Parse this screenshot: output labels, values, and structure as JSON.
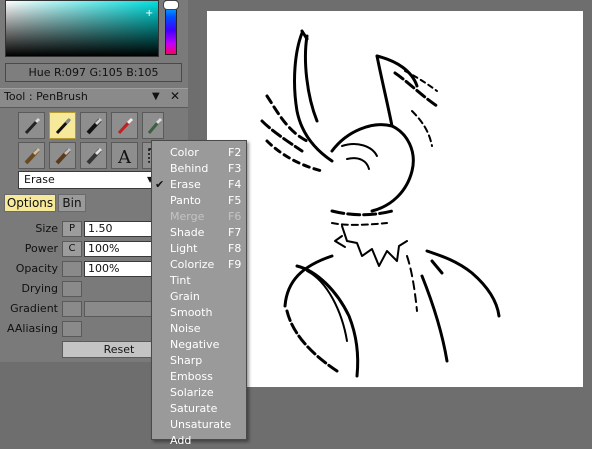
{
  "color_panel": {
    "readout": "Hue R:097 G:105 B:105"
  },
  "tool_panel": {
    "title": "Tool : PenBrush",
    "tools": [
      {
        "name": "pencil",
        "icon": "pencil-icon"
      },
      {
        "name": "pen-brush",
        "icon": "pen-brush-icon",
        "active": true
      },
      {
        "name": "marker",
        "icon": "marker-icon"
      },
      {
        "name": "airbrush",
        "icon": "airbrush-icon"
      },
      {
        "name": "blender",
        "icon": "blender-icon"
      },
      {
        "name": "paint-brush",
        "icon": "paint-brush-icon"
      },
      {
        "name": "water-brush",
        "icon": "water-brush-icon"
      },
      {
        "name": "smudge",
        "icon": "smudge-icon"
      },
      {
        "name": "text",
        "icon": "text-icon",
        "glyph": "A"
      },
      {
        "name": "select",
        "icon": "selection-icon"
      }
    ],
    "mode_value": "Erase",
    "tabs": {
      "options": "Options",
      "bin": "Bin"
    },
    "options": {
      "size": {
        "label": "Size",
        "button": "P",
        "value": "1.50"
      },
      "power": {
        "label": "Power",
        "button": "C",
        "value": "100%"
      },
      "opacity": {
        "label": "Opacity",
        "value": "100%"
      },
      "drying": {
        "label": "Drying"
      },
      "gradient": {
        "label": "Gradient"
      },
      "aaliasing": {
        "label": "AAliasing"
      },
      "reset": "Reset"
    }
  },
  "blend_menu": {
    "items": [
      {
        "label": "Color",
        "key": "F2"
      },
      {
        "label": "Behind",
        "key": "F3"
      },
      {
        "label": "Erase",
        "key": "F4",
        "checked": true
      },
      {
        "label": "Panto",
        "key": "F5"
      },
      {
        "label": "Merge",
        "key": "F6",
        "disabled": true
      },
      {
        "label": "Shade",
        "key": "F7"
      },
      {
        "label": "Light",
        "key": "F8"
      },
      {
        "label": "Colorize",
        "key": "F9"
      },
      {
        "label": "Tint",
        "key": ""
      },
      {
        "label": "Grain",
        "key": ""
      },
      {
        "label": "Smooth",
        "key": ""
      },
      {
        "label": "Noise",
        "key": ""
      },
      {
        "label": "Negative",
        "key": ""
      },
      {
        "label": "Sharp",
        "key": ""
      },
      {
        "label": "Emboss",
        "key": ""
      },
      {
        "label": "Solarize",
        "key": ""
      },
      {
        "label": "Saturate",
        "key": ""
      },
      {
        "label": "Unsaturate",
        "key": ""
      },
      {
        "label": "Add",
        "key": ""
      }
    ]
  },
  "colors": {
    "panel": "#7a7a7a",
    "active_tool": "#f6e99a",
    "menu_bg": "#9a9a9a",
    "canvas": "#ffffff"
  }
}
